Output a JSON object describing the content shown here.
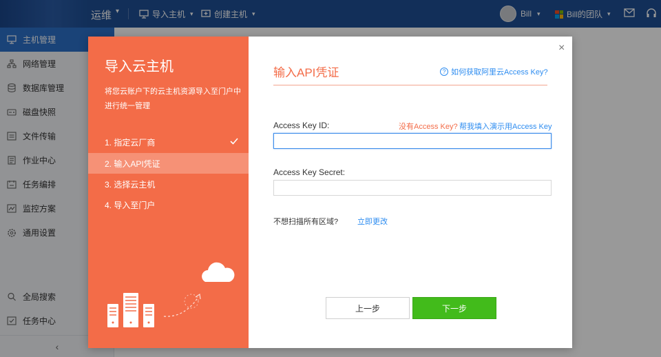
{
  "topbar": {
    "brand": "运维",
    "nav": [
      {
        "label": "导入主机",
        "icon": "import-host-icon"
      },
      {
        "label": "创建主机",
        "icon": "create-host-icon"
      }
    ],
    "user_name": "Bill",
    "team_name": "Bill的团队",
    "icons": [
      "mail-icon",
      "headset-icon"
    ]
  },
  "sidebar": {
    "items": [
      {
        "label": "主机管理",
        "icon": "monitor-icon",
        "active": true
      },
      {
        "label": "网络管理",
        "icon": "network-icon"
      },
      {
        "label": "数据库管理",
        "icon": "database-icon"
      },
      {
        "label": "磁盘快照",
        "icon": "disk-icon"
      },
      {
        "label": "文件传输",
        "icon": "file-transfer-icon"
      },
      {
        "label": "作业中心",
        "icon": "job-icon"
      },
      {
        "label": "任务编排",
        "icon": "orchestration-icon"
      },
      {
        "label": "监控方案",
        "icon": "monitoring-icon"
      },
      {
        "label": "通用设置",
        "icon": "settings-icon"
      }
    ],
    "bottom_items": [
      {
        "label": "全局搜索",
        "icon": "search-icon"
      },
      {
        "label": "任务中心",
        "icon": "task-center-icon"
      }
    ],
    "collapse_icon": "‹"
  },
  "wizard": {
    "title": "导入云主机",
    "description": "将您云账户下的云主机资源导入至门户中进行统一管理",
    "steps": [
      {
        "label": "1. 指定云厂商",
        "done": true
      },
      {
        "label": "2. 输入API凭证",
        "current": true
      },
      {
        "label": "3. 选择云主机"
      },
      {
        "label": "4. 导入至门户"
      }
    ]
  },
  "form": {
    "title": "输入API凭证",
    "help_link": "如何获取阿里云Access Key?",
    "access_key_id_label": "Access Key ID:",
    "no_key_text": "没有Access Key?",
    "demo_fill_text": "帮我填入演示用Access Key",
    "access_key_id_value": "",
    "access_key_secret_label": "Access Key Secret:",
    "access_key_secret_value": "",
    "scan_text": "不想扫描所有区域?",
    "scan_link": "立即更改",
    "prev_button": "上一步",
    "next_button": "下一步",
    "close": "×"
  },
  "colors": {
    "topbar": "#1e4f95",
    "sidebar_active": "#2c71c9",
    "wizard_accent": "#f36c48",
    "link": "#2d8cf0",
    "primary_button": "#42bb1b"
  }
}
